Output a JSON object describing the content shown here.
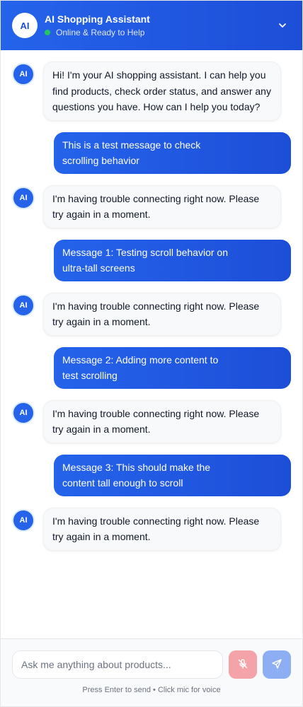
{
  "header": {
    "avatar_label": "AI",
    "title": "AI Shopping Assistant",
    "status": "Online & Ready to Help",
    "toggle_icon": "chevron-down-icon"
  },
  "messages": [
    {
      "sender": "ai",
      "avatar": "AI",
      "text": "Hi! I'm your AI shopping assistant. I can help you find products, check order status, and answer any questions you have. How can I help you today?"
    },
    {
      "sender": "user",
      "text": "This is a test message to check scrolling behavior"
    },
    {
      "sender": "ai",
      "avatar": "AI",
      "text": "I'm having trouble connecting right now. Please try again in a moment."
    },
    {
      "sender": "user",
      "text": "Message 1: Testing scroll behavior on ultra-tall screens"
    },
    {
      "sender": "ai",
      "avatar": "AI",
      "text": "I'm having trouble connecting right now. Please try again in a moment."
    },
    {
      "sender": "user",
      "text": "Message 2: Adding more content to test scrolling"
    },
    {
      "sender": "ai",
      "avatar": "AI",
      "text": "I'm having trouble connecting right now. Please try again in a moment."
    },
    {
      "sender": "user",
      "text": "Message 3: This should make the content tall enough to scroll"
    },
    {
      "sender": "ai",
      "avatar": "AI",
      "text": "I'm having trouble connecting right now. Please try again in a moment."
    }
  ],
  "composer": {
    "placeholder": "Ask me anything about products...",
    "value": "",
    "mic_icon": "mic-off-icon",
    "send_icon": "send-icon",
    "hint": "Press Enter to send • Click mic for voice"
  },
  "colors": {
    "accent": "#2563eb",
    "accent_dark": "#1d4ed8",
    "status_online": "#22c55e",
    "mic_button": "#f4a3a8",
    "send_button": "#8eaef4"
  }
}
